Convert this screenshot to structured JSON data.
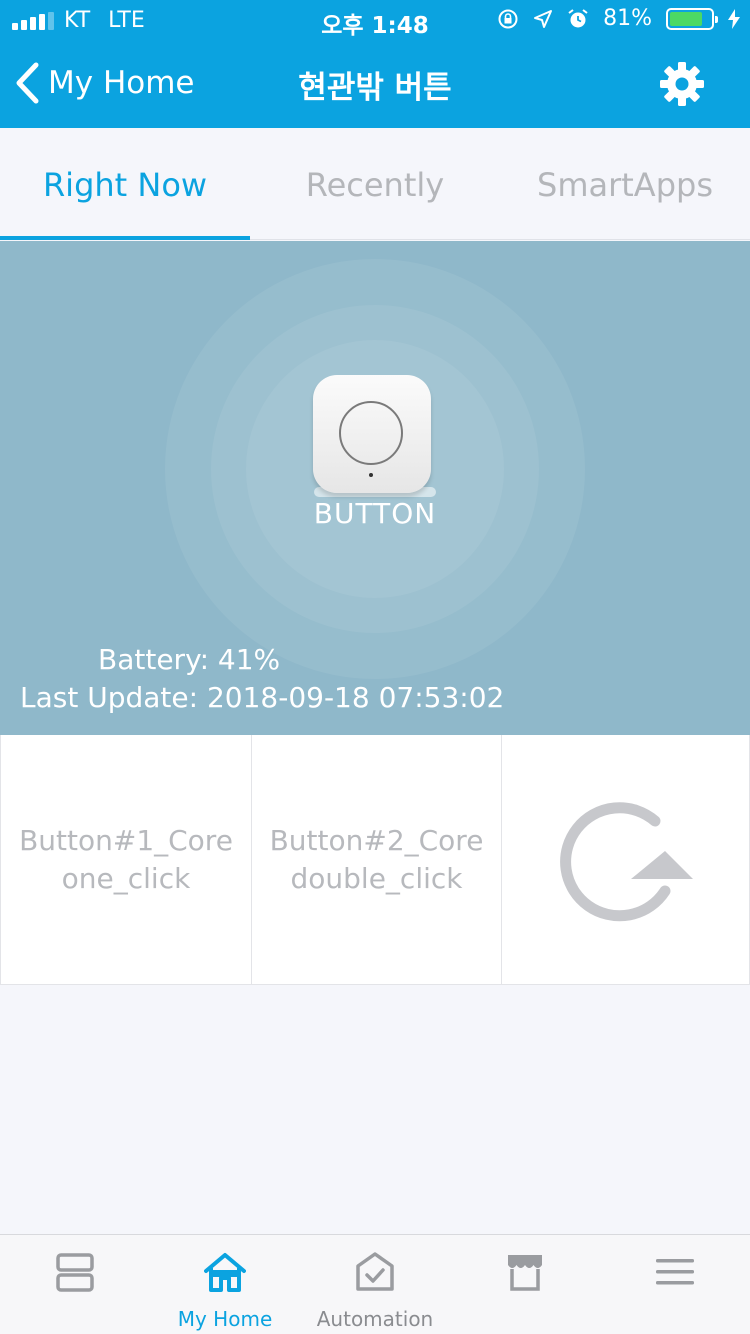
{
  "status_bar": {
    "carrier": "KT",
    "network": "LTE",
    "time": "오후 1:48",
    "battery_percent": "81%",
    "battery_level": 0.81,
    "battery_color": "#4cd964"
  },
  "nav": {
    "back_label": "My Home",
    "title": "현관밖 버튼",
    "settings_icon": "gear-icon"
  },
  "tabs": [
    {
      "label": "Right Now",
      "active": true
    },
    {
      "label": "Recently",
      "active": false
    },
    {
      "label": "SmartApps",
      "active": false
    }
  ],
  "device": {
    "name": "BUTTON",
    "battery": "Battery: 41%",
    "last_update": "Last Update: 2018-09-18 07:53:02",
    "tile_color": "#8fb8ca"
  },
  "actions": [
    {
      "line1": "Button#1_Core",
      "line2": "one_click"
    },
    {
      "line1": "Button#2_Core",
      "line2": "double_click"
    },
    {
      "icon": "refresh-icon"
    }
  ],
  "tabbar": [
    {
      "label": "",
      "icon": "dashboard-icon",
      "active": false
    },
    {
      "label": "My Home",
      "icon": "home-icon",
      "active": true
    },
    {
      "label": "Automation",
      "icon": "automation-icon",
      "active": false
    },
    {
      "label": "",
      "icon": "store-icon",
      "active": false
    },
    {
      "label": "",
      "icon": "menu-icon",
      "active": false
    }
  ],
  "colors": {
    "accent": "#0ba3e0",
    "inactive": "#b4b6ba"
  }
}
